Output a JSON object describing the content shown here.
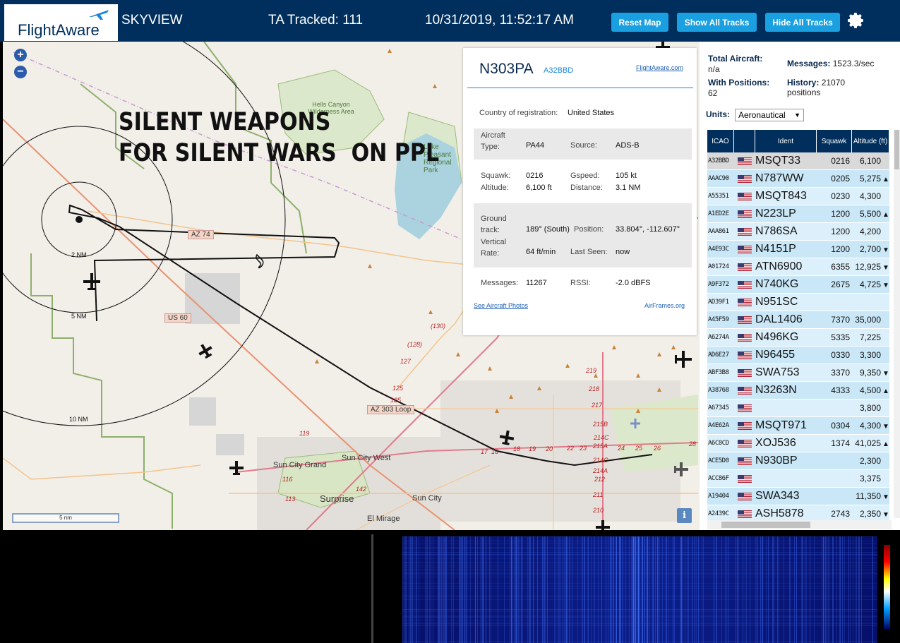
{
  "header": {
    "logo_text": "FlightAware",
    "app_name": "SKYVIEW",
    "tracked_label": "TA Tracked: 111",
    "datetime": "10/31/2019, 11:52:17 AM",
    "buttons": {
      "reset": "Reset Map",
      "show_all": "Show All Tracks",
      "hide_all": "Hide All Tracks"
    }
  },
  "map": {
    "overlay_text": "SILENT WEAPONS\nFOR SILENT WARS  ON PPL",
    "zoom_in": "+",
    "zoom_out": "−",
    "scale_label": "5 nm",
    "info_label": "i",
    "rings": [
      "2 NM",
      "5 NM",
      "10 NM"
    ],
    "place_labels": [
      "Hells Canyon Wilderness Area",
      "Lake Pleasant Regional Park",
      "Sun City Grand",
      "Sun City West",
      "Surprise",
      "Sun City",
      "El Mirage"
    ],
    "road_labels": {
      "az74": "AZ 74",
      "us60": "US 60",
      "az303": "AZ 303 Loop"
    },
    "route_numbers": [
      "(130)",
      "(128)",
      "127",
      "125",
      "125",
      "219",
      "218",
      "217",
      "215B",
      "214C",
      "215A",
      "214C",
      "214A",
      "212",
      "211",
      "210",
      "119",
      "116",
      "113",
      "142",
      "17",
      "16",
      "18",
      "19",
      "20",
      "22",
      "23",
      "24",
      "25",
      "26",
      "28"
    ]
  },
  "popup": {
    "ident": "N303PA",
    "hex": "A32BBD",
    "fa_link": "FlightAware.com",
    "country_label": "Country of registration:",
    "country": "United States",
    "aircraft_type_label": "Aircraft Type:",
    "aircraft_type": "PA44",
    "source_label": "Source:",
    "source": "ADS-B",
    "squawk_label": "Squawk:",
    "squawk": "0216",
    "altitude_label": "Altitude:",
    "altitude": "6,100 ft",
    "gspeed_label": "Gspeed:",
    "gspeed": "105 kt",
    "distance_label": "Distance:",
    "distance": "3.1 NM",
    "ground_track_label": "Ground track:",
    "ground_track": "189° (South)",
    "position_label": "Position:",
    "position": "33.804°, -112.607°",
    "vertical_rate_label": "Vertical Rate:",
    "vertical_rate": "64 ft/min",
    "last_seen_label": "Last Seen:",
    "last_seen": "now",
    "messages_label": "Messages:",
    "messages": "11267",
    "rssi_label": "RSSI:",
    "rssi": "-2.0 dBFS",
    "photos_link": "See Aircraft Photos",
    "airframes_link": "AirFrames.org"
  },
  "panel": {
    "total_label": "Total Aircraft:",
    "total_value": "n/a",
    "messages_label": "Messages:",
    "messages_value": "1523.3/sec",
    "with_pos_label": "With Positions:",
    "with_pos_value": "62",
    "history_label": "History:",
    "history_value": "21070 positions",
    "units_label": "Units:",
    "units_value": "Aeronautical",
    "columns": [
      "ICAO",
      "",
      "Ident",
      "Squawk",
      "Altitude (ft)"
    ],
    "rows": [
      {
        "icao": "A32BBD",
        "ident": "MSQT33",
        "squawk": "0216",
        "alt": "6,100",
        "trend": ""
      },
      {
        "icao": "AAAC90",
        "ident": "N787WW",
        "squawk": "0205",
        "alt": "5,275",
        "trend": "▲"
      },
      {
        "icao": "A55351",
        "ident": "MSQT843",
        "squawk": "0230",
        "alt": "4,300",
        "trend": ""
      },
      {
        "icao": "A1ED2E",
        "ident": "N223LP",
        "squawk": "1200",
        "alt": "5,500",
        "trend": "▲"
      },
      {
        "icao": "AAA861",
        "ident": "N786SA",
        "squawk": "1200",
        "alt": "4,200",
        "trend": ""
      },
      {
        "icao": "A4E93C",
        "ident": "N4151P",
        "squawk": "1200",
        "alt": "2,700",
        "trend": "▼"
      },
      {
        "icao": "A01724",
        "ident": "ATN6900",
        "squawk": "6355",
        "alt": "12,925",
        "trend": "▼"
      },
      {
        "icao": "A9F372",
        "ident": "N740KG",
        "squawk": "2675",
        "alt": "4,725",
        "trend": "▼"
      },
      {
        "icao": "AD39F1",
        "ident": "N951SC",
        "squawk": "",
        "alt": "",
        "trend": ""
      },
      {
        "icao": "A45F59",
        "ident": "DAL1406",
        "squawk": "7370",
        "alt": "35,000",
        "trend": ""
      },
      {
        "icao": "A6274A",
        "ident": "N496KG",
        "squawk": "5335",
        "alt": "7,225",
        "trend": ""
      },
      {
        "icao": "AD6E27",
        "ident": "N96455",
        "squawk": "0330",
        "alt": "3,300",
        "trend": ""
      },
      {
        "icao": "ABF3B8",
        "ident": "SWA753",
        "squawk": "3370",
        "alt": "9,350",
        "trend": "▼"
      },
      {
        "icao": "A38768",
        "ident": "N3263N",
        "squawk": "4333",
        "alt": "4,500",
        "trend": "▲"
      },
      {
        "icao": "A67345",
        "ident": "",
        "squawk": "",
        "alt": "3,800",
        "trend": ""
      },
      {
        "icao": "A4E62A",
        "ident": "MSQT971",
        "squawk": "0304",
        "alt": "4,300",
        "trend": "▼"
      },
      {
        "icao": "A6C8CD",
        "ident": "XOJ536",
        "squawk": "1374",
        "alt": "41,025",
        "trend": "▲"
      },
      {
        "icao": "ACE5D0",
        "ident": "N930BP",
        "squawk": "",
        "alt": "2,300",
        "trend": ""
      },
      {
        "icao": "ACC86F",
        "ident": "",
        "squawk": "",
        "alt": "3,375",
        "trend": ""
      },
      {
        "icao": "A19404",
        "ident": "SWA343",
        "squawk": "",
        "alt": "11,350",
        "trend": "▼"
      },
      {
        "icao": "A2439C",
        "ident": "ASH5878",
        "squawk": "2743",
        "alt": "2,350",
        "trend": "▼"
      }
    ]
  },
  "colors": {
    "header_bg": "#002F5D",
    "button_bg": "#1A9FE0",
    "table_head": "#002F5D",
    "row_light": "#DCF0FB",
    "row_dark": "#C9E7F7"
  }
}
